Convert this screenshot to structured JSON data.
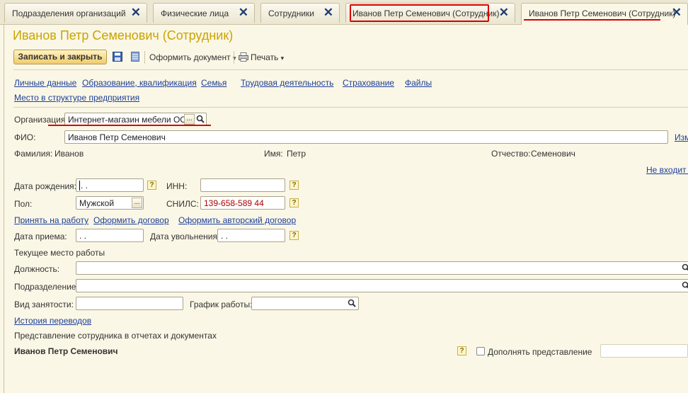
{
  "tabs": [
    {
      "label": "Подразделения организаций",
      "close": "✕"
    },
    {
      "label": "Физические лица",
      "close": "✕"
    },
    {
      "label": "Сотрудники",
      "close": "✕"
    },
    {
      "label": "Иванов Петр Семенович (Сотрудник)",
      "close": "✕"
    },
    {
      "label": "Иванов Петр Семенович (Сотрудник)",
      "close": "✕"
    }
  ],
  "title": "Иванов Петр Семенович (Сотрудник)",
  "toolbar": {
    "save_close": "Записать и закрыть",
    "doc": "Оформить документ",
    "print": "Печать"
  },
  "sections": {
    "personal": "Личные данные",
    "education": "Образование, квалификация",
    "family": "Семья",
    "labor": "Трудовая деятельность",
    "insurance": "Страхование",
    "files": "Файлы",
    "place": "Место в структуре предприятия"
  },
  "org": {
    "label": "Организация:",
    "value": "Интернет-магазин мебели ООО"
  },
  "fio": {
    "label": "ФИО:",
    "value": "Иванов Петр Семенович",
    "link": "Изм"
  },
  "name_parts": {
    "last_label": "Фамилия:",
    "last": "Иванов",
    "first_label": "Имя:",
    "first": "Петр",
    "middle_label": "Отчество:",
    "middle": "Семенович"
  },
  "not_in_link": "Не входит в",
  "birth": {
    "label": "Дата рождения:",
    "value": " .  ."
  },
  "inn": {
    "label": "ИНН:",
    "value": ""
  },
  "gender": {
    "label": "Пол:",
    "value": "Мужской"
  },
  "snils": {
    "label": "СНИЛС:",
    "value": "139-658-589 44"
  },
  "hire_links": {
    "hire": "Принять на работу",
    "contract": "Оформить договор",
    "author": "Оформить авторский договор"
  },
  "hire_date": {
    "label": "Дата приема:",
    "value": " .  ."
  },
  "fire_date": {
    "label": "Дата увольнения:",
    "value": " .  ."
  },
  "current_place": "Текущее место работы",
  "position": {
    "label": "Должность:",
    "value": ""
  },
  "division": {
    "label": "Подразделение:",
    "value": ""
  },
  "employment": {
    "label": "Вид занятости:",
    "value": ""
  },
  "schedule": {
    "label": "График работы:",
    "value": ""
  },
  "history_link": "История переводов",
  "presentation": {
    "heading": "Представление сотрудника в отчетах и документах",
    "value": "Иванов Петр Семенович",
    "checkbox_label": "Дополнять представление"
  },
  "glyphs": {
    "ellipsis": "...",
    "help": "?",
    "caret": "▾",
    "search": "search-icon"
  },
  "colors": {
    "accent_title": "#c9a400",
    "link": "#1d3f99",
    "highlight": "#d90000",
    "snils_text": "#b00000"
  }
}
